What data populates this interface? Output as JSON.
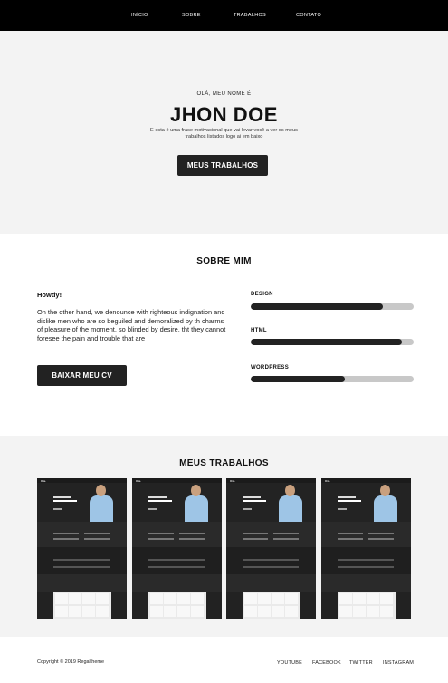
{
  "nav": {
    "items": [
      "INÍCIO",
      "SOBRE",
      "TRABALHOS",
      "CONTATO"
    ]
  },
  "hero": {
    "greeting": "OLÁ, MEU NOME É",
    "name": "JHON DOE",
    "motto": "E esta é uma frase motivacional que vai levar você a ver os meus trabalhos listados logo ai em baixo",
    "button": "MEUS TRABALHOS"
  },
  "about": {
    "title": "SOBRE MIM",
    "howdy": "Howdy!",
    "paragraph": "On the other hand, we denounce with righteous indignation and dislike men who are so beguiled and demoralized by th charms of pleasure of the moment, so blinded by desire, tht they cannot foresee the pain and trouble that are",
    "button": "BAIXAR MEU CV",
    "skills": [
      {
        "label": "DESIGN",
        "level": 0.81
      },
      {
        "label": "HTML",
        "level": 0.93
      },
      {
        "label": "WORDPRESS",
        "level": 0.58
      }
    ]
  },
  "works": {
    "title": "MEUS TRABALHOS",
    "thumbnails": [
      {
        "logo": "Rita."
      },
      {
        "logo": "Rita."
      },
      {
        "logo": "Rita."
      },
      {
        "logo": "Rita."
      }
    ]
  },
  "footer": {
    "copyright": "Copyright © 2019 Regaltheme",
    "links": [
      "YOUTUBE",
      "FACEBOOK",
      "TWITTER",
      "INSTAGRAM"
    ]
  }
}
